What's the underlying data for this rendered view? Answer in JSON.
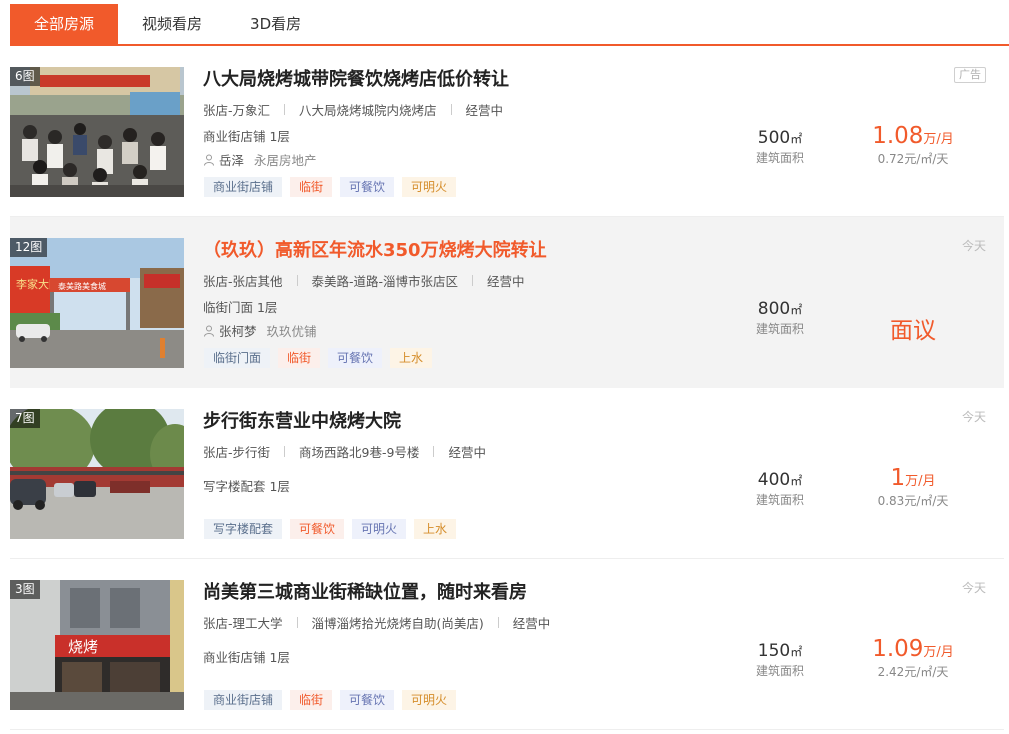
{
  "tabs": [
    {
      "label": "全部房源",
      "active": true
    },
    {
      "label": "视频看房",
      "active": false
    },
    {
      "label": "3D看房",
      "active": false
    }
  ],
  "listings": [
    {
      "photo_count": "6图",
      "title": "八大局烧烤城带院餐饮烧烤店低价转让",
      "title_color": "#222222",
      "district": "张店-万象汇",
      "address": "八大局烧烤城院内烧烤店",
      "status": "经营中",
      "type_floor": "商业街店铺 1层",
      "agent": "岳泽",
      "company": "永居房地产",
      "tags": [
        "商业街店铺",
        "临街",
        "可餐饮",
        "可明火"
      ],
      "area_value": "500",
      "area_unit": "㎡",
      "area_label": "建筑面积",
      "price_value": "1.08",
      "price_unit": "万/月",
      "price_daily": "0.72元/㎡/天",
      "badge": "广告"
    },
    {
      "photo_count": "12图",
      "title": "（玖玖）高新区年流水350万烧烤大院转让",
      "title_color": "#f15a2b",
      "district": "张店-张店其他",
      "address": "泰美路-道路-淄博市张店区",
      "status": "经营中",
      "type_floor": "临街门面 1层",
      "agent": "张柯梦",
      "company": "玖玖优铺",
      "tags": [
        "临街门面",
        "临街",
        "可餐饮",
        "上水"
      ],
      "area_value": "800",
      "area_unit": "㎡",
      "area_label": "建筑面积",
      "price_text": "面议",
      "date": "今天"
    },
    {
      "photo_count": "7图",
      "title": "步行街东营业中烧烤大院",
      "title_color": "#222222",
      "district": "张店-步行街",
      "address": "商场西路北9巷-9号楼",
      "status": "经营中",
      "type_floor": "写字楼配套 1层",
      "tags": [
        "写字楼配套",
        "可餐饮",
        "可明火",
        "上水"
      ],
      "area_value": "400",
      "area_unit": "㎡",
      "area_label": "建筑面积",
      "price_value": "1",
      "price_unit": "万/月",
      "price_daily": "0.83元/㎡/天",
      "date": "今天"
    },
    {
      "photo_count": "3图",
      "title": "尚美第三城商业街稀缺位置，随时来看房",
      "title_color": "#222222",
      "district": "张店-理工大学",
      "address": "淄博淄烤拾光烧烤自助(尚美店)",
      "status": "经营中",
      "type_floor": "商业街店铺 1层",
      "tags": [
        "商业街店铺",
        "临街",
        "可餐饮",
        "可明火"
      ],
      "area_value": "150",
      "area_unit": "㎡",
      "area_label": "建筑面积",
      "price_value": "1.09",
      "price_unit": "万/月",
      "price_daily": "2.42元/㎡/天",
      "date": "今天"
    }
  ],
  "photo_signs": {
    "listing2_left": "李家大院",
    "listing2_banner": "泰美路美食城",
    "listing4_sign": "烧烤"
  },
  "colors": {
    "accent": "#f15a2b",
    "tab_active_bg": "#f15a2b",
    "highlight_row_bg": "#f3f3f3"
  }
}
